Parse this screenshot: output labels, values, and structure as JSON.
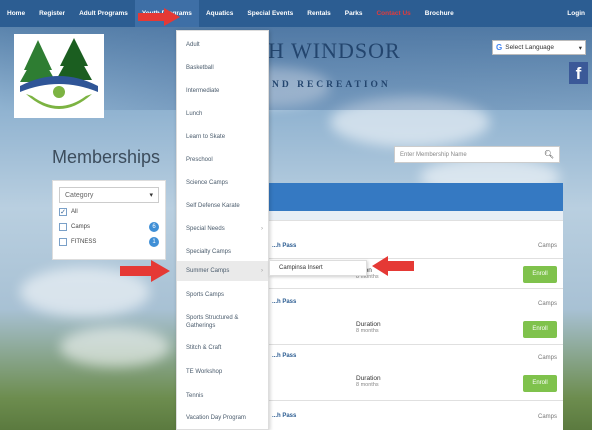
{
  "topnav": {
    "items": [
      "Home",
      "Register",
      "Adult Programs",
      "Youth Programs",
      "Aquatics",
      "Special Events",
      "Rentals",
      "Parks",
      "Contact Us",
      "Brochure",
      "Login"
    ]
  },
  "header": {
    "title": "H WINDSOR",
    "subtitle": "ND RECREATION",
    "language_button": "Select Language",
    "facebook": "f"
  },
  "page": {
    "heading": "Memberships",
    "search_placeholder": "Enter Membership Name"
  },
  "filter": {
    "label": "Category",
    "options": [
      {
        "label": "All",
        "checked": true
      },
      {
        "label": "Camps",
        "checked": false,
        "count": "6"
      },
      {
        "label": "FITNESS",
        "checked": false,
        "count": "1"
      }
    ]
  },
  "dropdown": {
    "items": [
      "Adult",
      "Basketball",
      "Intermediate",
      "Lunch",
      "Learn to Skate",
      "Preschool",
      "Science Camps",
      "Self Defense Karate",
      "Special Needs",
      "Specialty Camps",
      "Summer Camps",
      "Sports Camps",
      "Sports Structured & Gatherings",
      "Stitch & Craft",
      "TE Workshop",
      "Tennis",
      "Vacation Day Program"
    ],
    "submenu_item": "Campinsa Insert"
  },
  "listing": {
    "rows": [
      {
        "title": "...h Pass",
        "category": "Camps",
        "duration": "",
        "enroll": ""
      },
      {
        "title": "",
        "category": "",
        "duration": "...tion",
        "duration_sub": "8 months",
        "enroll": "Enroll"
      },
      {
        "title": "...h Pass",
        "category": "Camps",
        "duration": "Duration",
        "duration_sub": "8 months",
        "enroll": "Enroll"
      },
      {
        "title": "...h Pass",
        "category": "Camps",
        "duration": "Duration",
        "duration_sub": "8 months",
        "enroll": "Enroll"
      },
      {
        "title": "...h Pass",
        "category": "Camps",
        "duration": "",
        "enroll": ""
      }
    ]
  },
  "colors": {
    "nav": "#2c5d92",
    "accent": "#3579c2",
    "enroll": "#7fc24c",
    "arrow": "#e53935"
  }
}
